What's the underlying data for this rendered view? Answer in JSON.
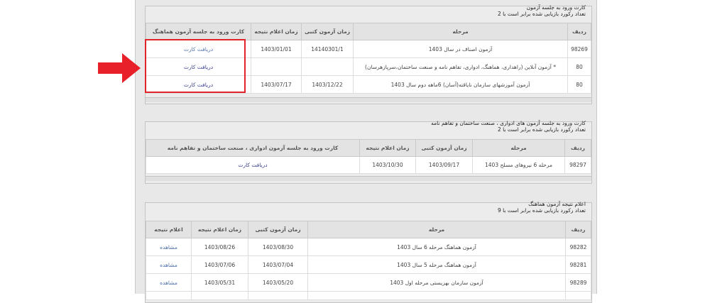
{
  "section1": {
    "title": "کارت ورود به جلسه آزمون",
    "count": "تعداد رکورد بازیابی شده برابر است با 2",
    "headers": [
      "ردیف",
      "مرحله",
      "زمان آزمون کتبی",
      "زمان اعلام نتیجه",
      "کارت ورود به جلسه آزمون هماهنگ"
    ],
    "rows": [
      {
        "id": "98269",
        "stage": "آزمون اصناف در سال 1403",
        "exam": "14140301/1",
        "result": "1403/01/01",
        "action": "دریافت کارت"
      },
      {
        "id": "80",
        "stage": "* آزمون آنلاین (راهداری، هماهنگ، ادواری، تفاهم نامه و صنعت ساختمان،سرپازهرسان)",
        "exam": "",
        "result": "",
        "action": "دریافت کارت"
      },
      {
        "id": "80",
        "stage": "آزمون آموزشهای سازمان نایاقته(آسان) 6ماهه دوم سال 1403",
        "exam": "1403/12/22",
        "result": "1403/07/17",
        "action": "دریافت کارت"
      }
    ]
  },
  "section2": {
    "title": "کارت ورود به جلسه آزمون های ادواری ، صنعت ساختمان و تفاهم نامه",
    "count": "تعداد رکورد بازیابی شده برابر است با 2",
    "headers": [
      "ردیف",
      "مرحله",
      "زمان آزمون کتبی",
      "زمان اعلام نتیجه",
      "کارت ورود به جلسه آزمون ادواری ، صنعت ساختمان و تفاهم نامه"
    ],
    "rows": [
      {
        "id": "98297",
        "stage": "مرحله 6 نیروهای مسلح 1403",
        "exam": "1403/09/17",
        "result": "1403/10/30",
        "action": "دریافت کارت"
      }
    ]
  },
  "section3": {
    "title": "اعلام نتیجه آزمون هماهنگ",
    "count": "تعداد رکورد بازیابی شده برابر است با 9",
    "headers": [
      "ردیف",
      "مرحله",
      "زمان آزمون کتبی",
      "زمان اعلام نتیجه",
      "اعلام نتیجه"
    ],
    "rows": [
      {
        "id": "98282",
        "stage": "آزمون هماهنگ مرحله 6 سال 1403",
        "exam": "1403/08/30",
        "result": "1403/08/26",
        "action": "مشاهده"
      },
      {
        "id": "98281",
        "stage": "آزمون هماهنگ مرحله 5 سال 1403",
        "exam": "1403/07/04",
        "result": "1403/07/06",
        "action": "مشاهده"
      },
      {
        "id": "98289",
        "stage": "آزمون سازمان بهزیستی مرحله اول 1403",
        "exam": "1403/05/20",
        "result": "1403/05/31",
        "action": "مشاهده"
      }
    ]
  },
  "colors": {
    "highlight": "#e0242a",
    "arrow": "#e8202a",
    "link": "#333a8a"
  }
}
